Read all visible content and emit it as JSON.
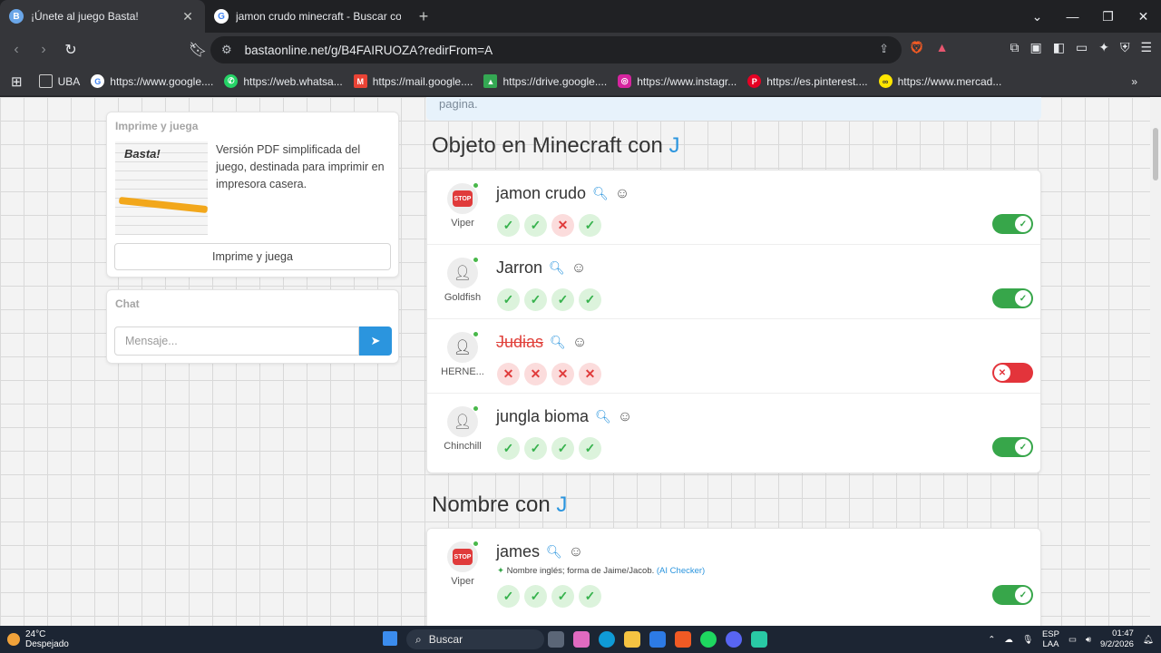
{
  "tabs": [
    {
      "title": "¡Únete al juego Basta!",
      "active": true
    },
    {
      "title": "jamon crudo minecraft - Buscar con G",
      "active": false
    }
  ],
  "address": {
    "url": "bastaonline.net/g/B4FAIRUOZA?redirFrom=A"
  },
  "bookmarks": [
    "UBA",
    "https://www.google....",
    "https://web.whatsa...",
    "https://mail.google....",
    "https://drive.google....",
    "https://www.instagr...",
    "https://es.pinterest....",
    "https://www.mercad..."
  ],
  "sidebar": {
    "print_card": {
      "title": "Imprime y juega",
      "description": "Versión PDF simplificada del juego, destinada para imprimir en impresora casera.",
      "button": "Imprime y juega",
      "image_logo": "Basta!"
    },
    "chat": {
      "title": "Chat",
      "placeholder": "Mensaje..."
    }
  },
  "info_text": "pagina.",
  "sections": [
    {
      "title": "Objeto en Minecraft con ",
      "letter": "J",
      "answers": [
        {
          "word": "jamon crudo",
          "user": "Viper",
          "avatar": "stop",
          "votes": [
            "ok",
            "ok",
            "no",
            "ok"
          ],
          "accepted": true
        },
        {
          "word": "Jarron",
          "user": "Goldfish",
          "avatar": "person",
          "votes": [
            "ok",
            "ok",
            "ok",
            "ok"
          ],
          "accepted": true
        },
        {
          "word": "Judias",
          "user": "HERNE...",
          "avatar": "person-star",
          "votes": [
            "no",
            "no",
            "no",
            "no"
          ],
          "accepted": false
        },
        {
          "word": "jungla bioma",
          "user": "Chinchill",
          "avatar": "person",
          "votes": [
            "ok",
            "ok",
            "ok",
            "ok"
          ],
          "accepted": true
        }
      ]
    },
    {
      "title": "Nombre con ",
      "letter": "J",
      "answers": [
        {
          "word": "james",
          "user": "Viper",
          "avatar": "stop",
          "note": "Nombre inglés; forma de Jaime/Jacob.",
          "note_link": "(AI Checker)",
          "votes": [
            "ok",
            "ok",
            "ok",
            "ok"
          ],
          "accepted": true
        }
      ]
    }
  ],
  "taskbar": {
    "temp": "24°C",
    "weather": "Despejado",
    "search": "Buscar",
    "lang1": "ESP",
    "lang2": "LAA",
    "time": "01:47",
    "date": "9/2/2026"
  },
  "colors": {
    "accent": "#2b95de",
    "ok": "#37a64a",
    "error": "#e3343b"
  }
}
